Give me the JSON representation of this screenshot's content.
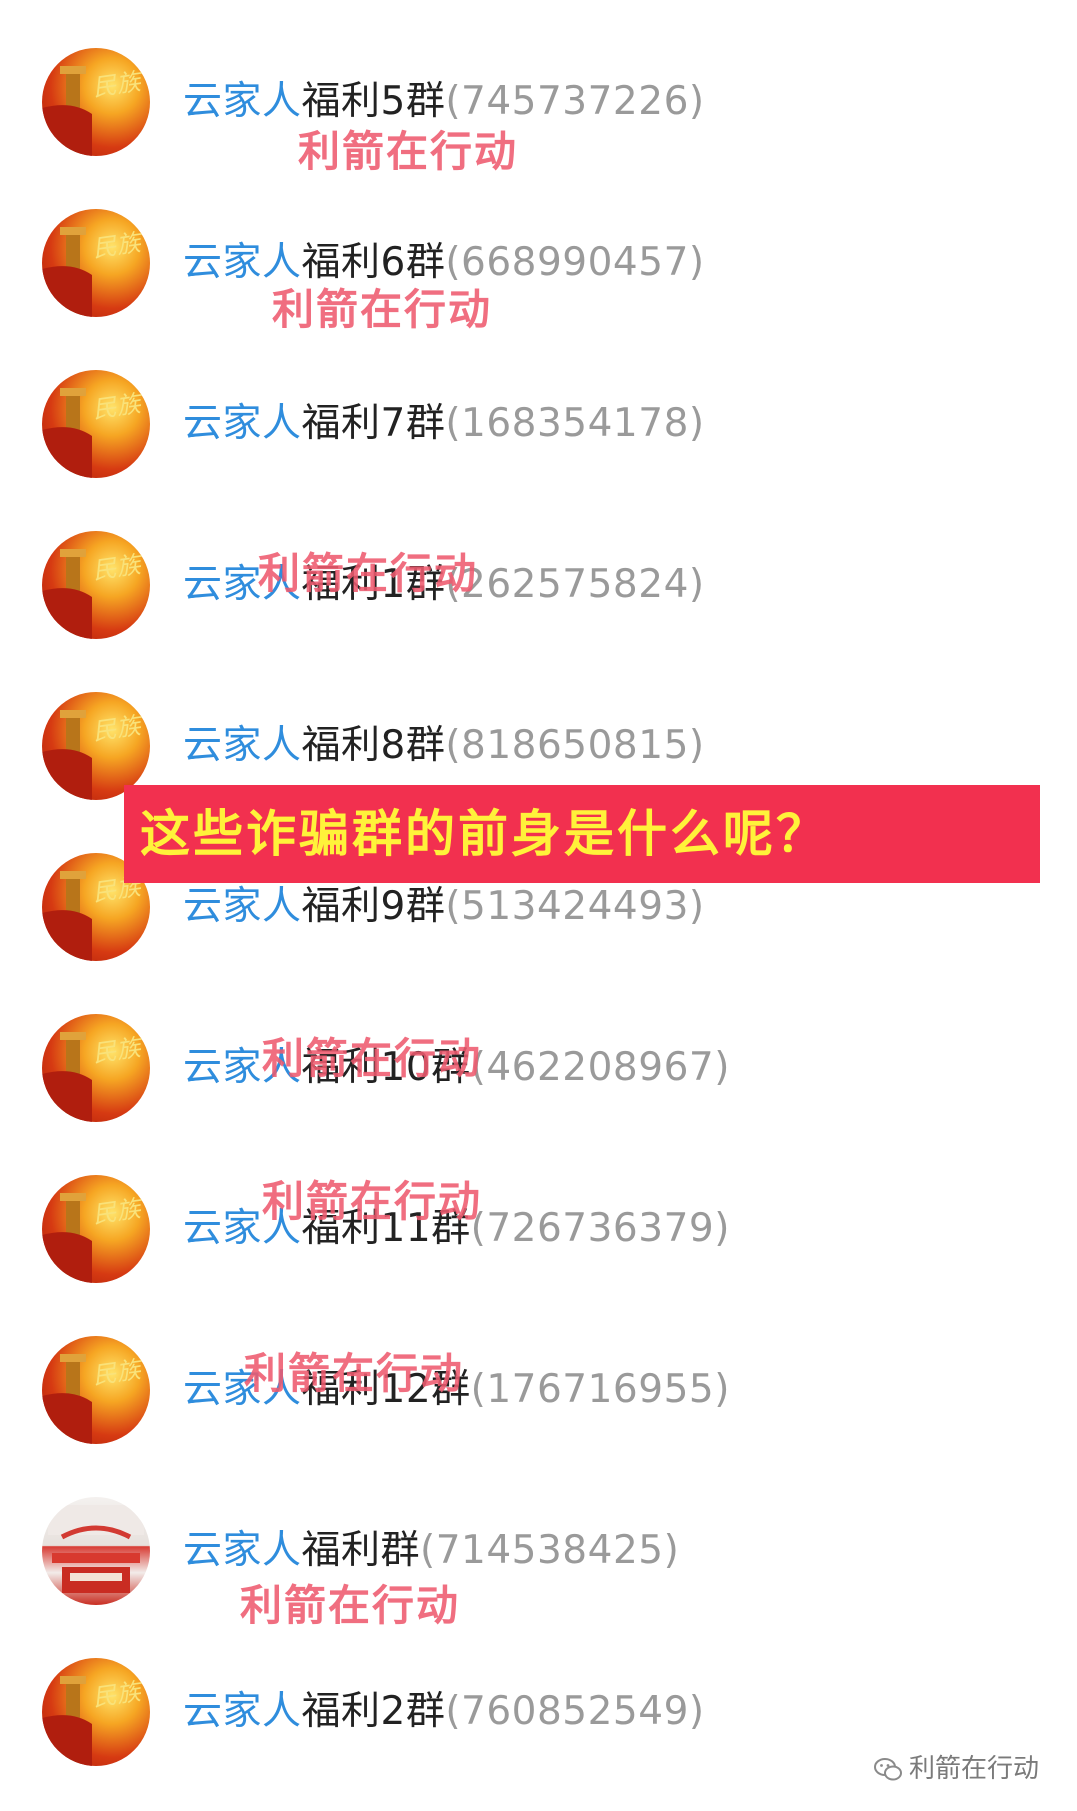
{
  "groups": [
    {
      "prefix": "云家人",
      "group": "福利5群",
      "id": "(745737226)",
      "avatar": "national-emblem-avatar"
    },
    {
      "prefix": "云家人",
      "group": "福利6群",
      "id": "(668990457)",
      "avatar": "national-emblem-avatar"
    },
    {
      "prefix": "云家人",
      "group": "福利7群",
      "id": "(168354178)",
      "avatar": "national-emblem-avatar"
    },
    {
      "prefix": "云家人",
      "group": "福利1群",
      "id": "(262575824)",
      "avatar": "national-emblem-avatar"
    },
    {
      "prefix": "云家人",
      "group": "福利8群",
      "id": "(818650815)",
      "avatar": "national-emblem-avatar"
    },
    {
      "prefix": "云家人",
      "group": "福利9群",
      "id": "(513424493)",
      "avatar": "national-emblem-avatar"
    },
    {
      "prefix": "云家人",
      "group": "福利10群",
      "id": "(462208967)",
      "avatar": "national-emblem-avatar"
    },
    {
      "prefix": "云家人",
      "group": "福利11群",
      "id": "(726736379)",
      "avatar": "national-emblem-avatar"
    },
    {
      "prefix": "云家人",
      "group": "福利12群",
      "id": "(176716955)",
      "avatar": "national-emblem-avatar"
    },
    {
      "prefix": "云家人",
      "group": "福利群",
      "id": "(714538425)",
      "avatar": "building-photo-avatar"
    },
    {
      "prefix": "云家人",
      "group": "福利2群",
      "id": "(760852549)",
      "avatar": "national-emblem-avatar"
    }
  ],
  "avatar_badge_text": "民族",
  "watermark_text": "利箭在行动",
  "banner": {
    "text": "这些诈骗群的前身是什么呢？"
  },
  "footer": {
    "icon": "wechat-icon",
    "text": "利箭在行动"
  },
  "colors": {
    "prefix": "#2f8ddd",
    "group_name": "#222222",
    "group_id": "#9a9a9a",
    "watermark": "#ee5a6e",
    "banner_bg": "#f2304f",
    "banner_text": "#fff23a"
  }
}
